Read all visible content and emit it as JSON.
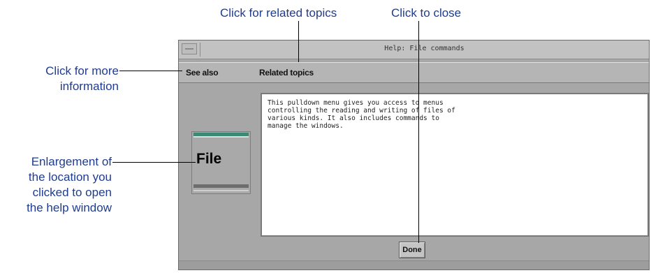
{
  "callouts": {
    "related_topics": "Click for related topics",
    "close": "Click to close",
    "more_info_line1": "Click for more",
    "more_info_line2": "information",
    "enlargement_line1": "Enlargement of",
    "enlargement_line2": "the location you",
    "enlargement_line3": "clicked to open",
    "enlargement_line4": "the help window"
  },
  "window": {
    "title": "Help: File commands",
    "menu": {
      "see_also": "See also",
      "related_topics": "Related topics"
    },
    "enlargement_label": "File",
    "help_text": "This pulldown menu gives you access to menus\ncontrolling the reading and writing of files of\nvarious kinds.  It also includes commands to\nmanage the windows.",
    "done_label": "Done"
  },
  "colors": {
    "callout_text": "#1f3c8f",
    "window_bg": "#a7a7a7",
    "accent_bar": "#3c8a76"
  }
}
